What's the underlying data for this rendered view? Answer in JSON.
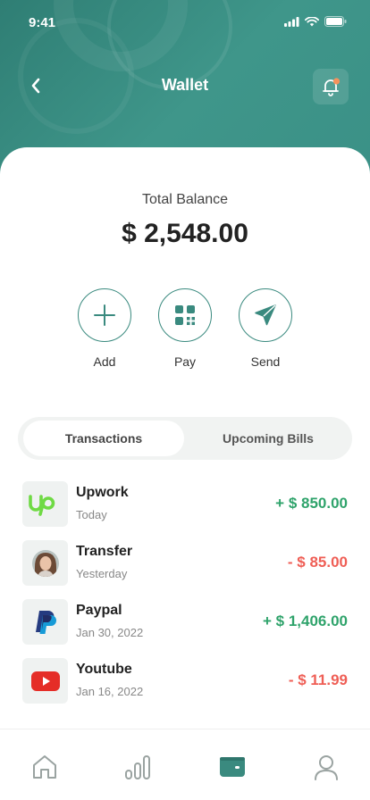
{
  "status_bar": {
    "time": "9:41"
  },
  "header": {
    "title": "Wallet"
  },
  "balance": {
    "label": "Total Balance",
    "value": "$ 2,548.00"
  },
  "actions": [
    {
      "label": "Add",
      "icon": "plus-icon"
    },
    {
      "label": "Pay",
      "icon": "qr-code-icon"
    },
    {
      "label": "Send",
      "icon": "send-icon"
    }
  ],
  "tabs": [
    {
      "label": "Transactions",
      "active": true
    },
    {
      "label": "Upcoming Bills",
      "active": false
    }
  ],
  "transactions": [
    {
      "name": "Upwork",
      "date": "Today",
      "amount": "+ $ 850.00",
      "type": "income",
      "icon": "upwork-logo"
    },
    {
      "name": "Transfer",
      "date": "Yesterday",
      "amount": "- $ 85.00",
      "type": "expense",
      "icon": "user-avatar"
    },
    {
      "name": "Paypal",
      "date": "Jan 30, 2022",
      "amount": "+ $ 1,406.00",
      "type": "income",
      "icon": "paypal-logo"
    },
    {
      "name": "Youtube",
      "date": "Jan 16, 2022",
      "amount": "- $ 11.99",
      "type": "expense",
      "icon": "youtube-logo"
    }
  ],
  "bottom_nav": [
    {
      "name": "home",
      "icon": "home-icon",
      "active": false
    },
    {
      "name": "stats",
      "icon": "bar-chart-icon",
      "active": false
    },
    {
      "name": "wallet",
      "icon": "wallet-icon",
      "active": true
    },
    {
      "name": "profile",
      "icon": "user-icon",
      "active": false
    }
  ],
  "colors": {
    "brand": "#3a8a7f",
    "income": "#2fa36b",
    "expense": "#ef5e55",
    "notification_dot": "#f6925c"
  }
}
